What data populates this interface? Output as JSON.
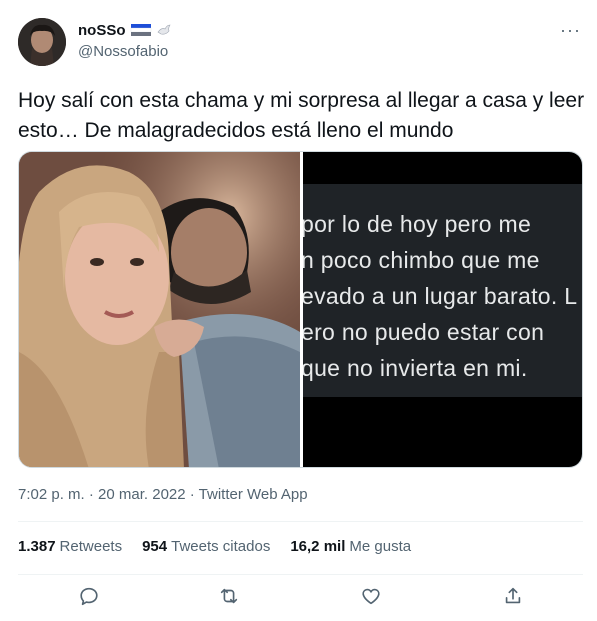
{
  "author": {
    "display_name": "noSSo",
    "username": "@Nossofabio"
  },
  "tweet": {
    "text": "Hoy salí con esta chama y mi sorpresa al llegar a casa y leer esto… De malagradecidos está lleno el mundo"
  },
  "media": {
    "screenshot_lines": [
      "por lo de hoy pero me",
      "n poco chimbo que me",
      "evado a un lugar barato. L",
      "ero no puedo estar con",
      "que no invierta en mi."
    ]
  },
  "meta": {
    "time": "7:02 p. m.",
    "separator1": " · ",
    "date": "20 mar. 2022",
    "separator2": " · ",
    "source": "Twitter Web App"
  },
  "stats": {
    "retweets_count": "1.387",
    "retweets_label": "Retweets",
    "quotes_count": "954",
    "quotes_label": "Tweets citados",
    "likes_count": "16,2 mil",
    "likes_label": "Me gusta"
  },
  "icons": {
    "more": "more-horizontal-icon",
    "flag": "flag-icon",
    "dove": "dove-icon",
    "reply": "reply-icon",
    "retweet": "retweet-icon",
    "like": "heart-icon",
    "share": "share-icon"
  },
  "colors": {
    "text_primary": "#0f1419",
    "text_secondary": "#536471",
    "border": "#eff3f4"
  }
}
